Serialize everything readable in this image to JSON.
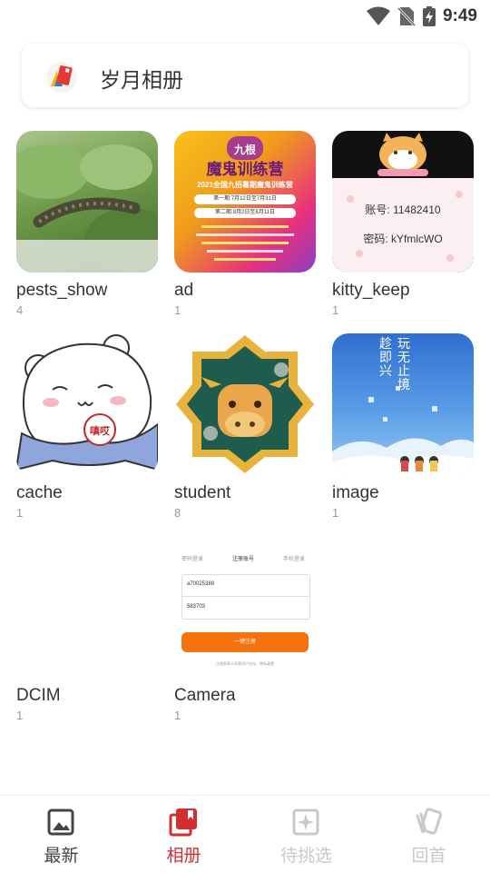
{
  "status_bar": {
    "time": "9:49"
  },
  "header": {
    "title": "岁月相册"
  },
  "albums": [
    {
      "name": "pests_show",
      "count": "4"
    },
    {
      "name": "ad",
      "count": "1"
    },
    {
      "name": "kitty_keep",
      "count": "1"
    },
    {
      "name": "cache",
      "count": "1"
    },
    {
      "name": "student",
      "count": "8"
    },
    {
      "name": "image",
      "count": "1"
    },
    {
      "name": "DCIM",
      "count": "1"
    },
    {
      "name": "Camera",
      "count": "1"
    }
  ],
  "thumb_text": {
    "ad": {
      "brand": "九根",
      "headline": "魔鬼训练营",
      "subtitle": "2021全国九招暑期魔鬼训练营",
      "period1": "第一期:7月12日至7月31日",
      "period2": "第二期:8月2日至8月11日"
    },
    "kitty": {
      "account": "账号: 11482410",
      "password": "密码: kYfmlcWO"
    },
    "cache_badge": "嗔哎",
    "image_poster": {
      "title": "玩无止境",
      "title2": "趁即兴"
    },
    "camera": {
      "tab1": "密码登录",
      "tab2": "注册账号",
      "tab3": "手机登录",
      "field1": "a70025388",
      "field2": "583703",
      "button": "一键注册",
      "footer": "注册即表示同意用户协议、隐私政策"
    }
  },
  "bottom_nav": [
    {
      "label": "最新",
      "icon": "image-icon",
      "active": false
    },
    {
      "label": "相册",
      "icon": "album-icon",
      "active": true
    },
    {
      "label": "待挑选",
      "icon": "sparkle-icon",
      "active": false
    },
    {
      "label": "回首",
      "icon": "cards-icon",
      "active": false
    }
  ],
  "colors": {
    "accent": "#d32f2f",
    "inactive": "#444444",
    "disabled": "#c8c8c8"
  }
}
